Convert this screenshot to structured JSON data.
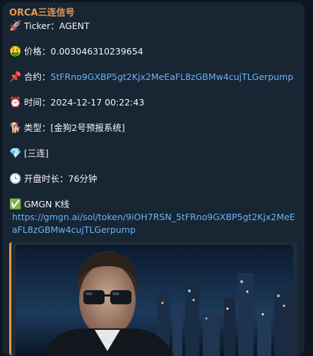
{
  "message": {
    "sender": "ORCA三连信号",
    "ticker_label": "Ticker：",
    "ticker_value": "AGENT",
    "price_label": "价格：",
    "price_value": "0.003046310239654",
    "contract_label": "合约：",
    "contract_value": "5tFRno9GXBP5gt2Kjx2MeEaFL8zGBMw4cujTLGerpump",
    "time_label": "时间：",
    "time_value": "2024-12-17 00:22:43",
    "type_label": "类型：",
    "type_value": "[金狗2号预报系统]",
    "tier_value": "[三连]",
    "duration_label": "开盘时长：",
    "duration_value": "76分钟",
    "gmgn_label": "GMGN K线",
    "gmgn_url": "https://gmgn.ai/sol/token/9iOH7RSN_5tFRno9GXBP5gt2Kjx2MeEaFL8zGBMw4cujTLGerpump"
  },
  "icons": {
    "ticker": "rocket-icon",
    "price": "money-mouth-face-icon",
    "contract": "pushpin-icon",
    "time": "alarm-clock-icon",
    "type": "dog-icon",
    "tier": "gem-icon",
    "duration": "clock-icon",
    "gmgn": "check-mark-icon"
  },
  "colors": {
    "background": "#0e1621",
    "bubble": "#182533",
    "sender": "#e89a4f",
    "link": "#6ab3f3",
    "text": "#f5f5f5"
  }
}
